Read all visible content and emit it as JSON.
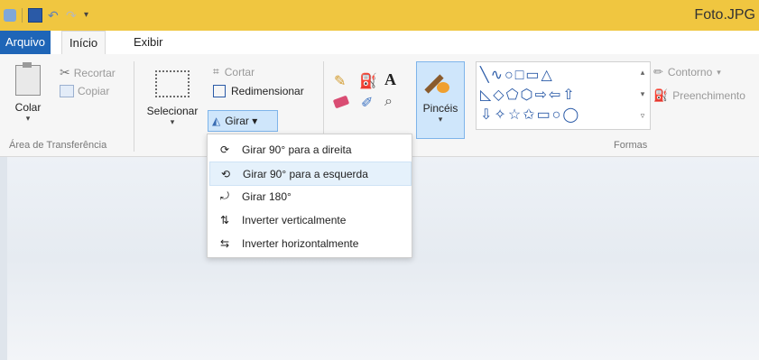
{
  "window": {
    "title": "Foto.JPG"
  },
  "tabs": {
    "file": "Arquivo",
    "home": "Início",
    "view": "Exibir"
  },
  "clipboard": {
    "paste": "Colar",
    "cut": "Recortar",
    "copy": "Copiar",
    "label": "Área de Transferência"
  },
  "image": {
    "select": "Selecionar",
    "crop": "Cortar",
    "resize": "Redimensionar",
    "rotate": "Girar ▾"
  },
  "brushes": {
    "label": "Pincéis"
  },
  "shapes": {
    "label": "Formas",
    "outline": "Contorno",
    "fill": "Preenchimento"
  },
  "rotate_menu": {
    "items": [
      "Girar 90° para a direita",
      "Girar 90° para a esquerda",
      "Girar 180°",
      "Inverter verticalmente",
      "Inverter horizontalmente"
    ],
    "highlighted_index": 1
  },
  "colors": {
    "accent": "#1e65b7",
    "titlebar": "#f0c640"
  }
}
